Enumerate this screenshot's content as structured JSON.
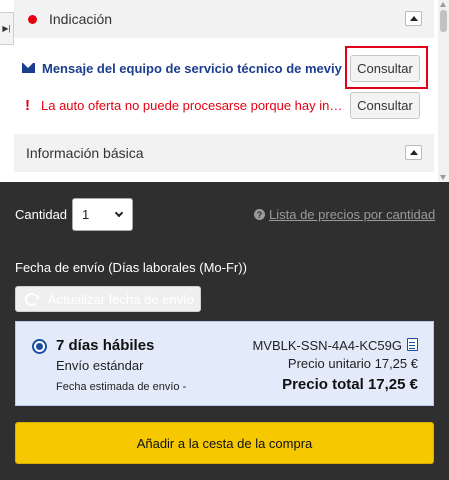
{
  "indication": {
    "title": "Indicación"
  },
  "messages": [
    {
      "text": "Mensaje del equipo de servicio técnico de meviy",
      "button": "Consultar"
    },
    {
      "text": "La auto oferta no puede procesarse porque hay in…",
      "button": "Consultar"
    }
  ],
  "basic_info": {
    "title": "Información básica"
  },
  "quantity": {
    "label": "Cantidad",
    "value": "1"
  },
  "price_list_link": "Lista de precios por cantidad",
  "shipping": {
    "label": "Fecha de envío (Días laborales (Mo-Fr))",
    "refresh_button": "Actualizar fecha de envío"
  },
  "delivery": {
    "days": "7 días hábiles",
    "type": "Envío estándar",
    "estimated": "Fecha estimada de envío -",
    "part_number": "MVBLK-SSN-4A4-KC59G",
    "unit_price": "Precio unitario 17,25 €",
    "total_price": "Precio total 17,25 €"
  },
  "cart_button": "Añadir a la cesta de la compra",
  "colors": {
    "accent": "#1d3d8f",
    "alert": "#e60012",
    "cart": "#f5c800",
    "dark_bg": "#2f2f2f"
  }
}
